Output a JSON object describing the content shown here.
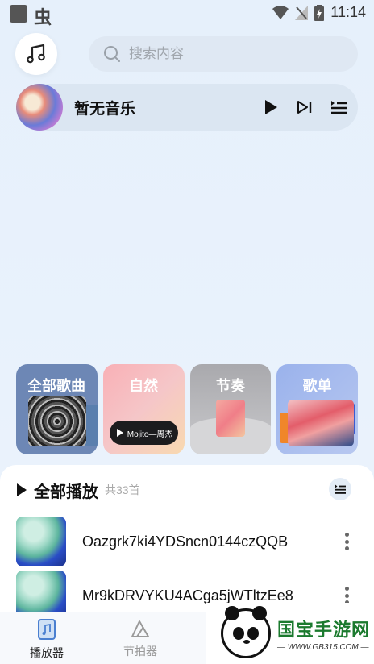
{
  "status_bar": {
    "app_glyph": "虫",
    "time": "11:14",
    "icons": [
      "wifi-icon",
      "no-signal-icon",
      "battery-charging-icon"
    ]
  },
  "header": {
    "music_icon": "music-note-icon",
    "search_placeholder": "搜索内容"
  },
  "player": {
    "title": "暂无音乐",
    "controls": [
      "play-icon",
      "next-icon",
      "playlist-icon"
    ]
  },
  "categories": [
    {
      "label": "全部歌曲"
    },
    {
      "label": "自然",
      "pill_text": "Mojito—周杰"
    },
    {
      "label": "节奏"
    },
    {
      "label": "歌单"
    }
  ],
  "list": {
    "title": "全部播放",
    "count": "共33首",
    "songs": [
      {
        "name": "Oazgrk7ki4YDSncn0144czQQB"
      },
      {
        "name": "Mr9kDRVYKU4ACga5jWTltzEe8"
      }
    ]
  },
  "nav": {
    "items": [
      {
        "label": "播放器",
        "active": true
      },
      {
        "label": "节拍器",
        "active": false
      }
    ]
  },
  "watermark": {
    "title": "国宝手游网",
    "url": "— WWW.GB315.COM —"
  },
  "colors": {
    "background": "#e6f0fb",
    "nav_active": "#222222",
    "watermark_green": "#1b7a2e"
  }
}
